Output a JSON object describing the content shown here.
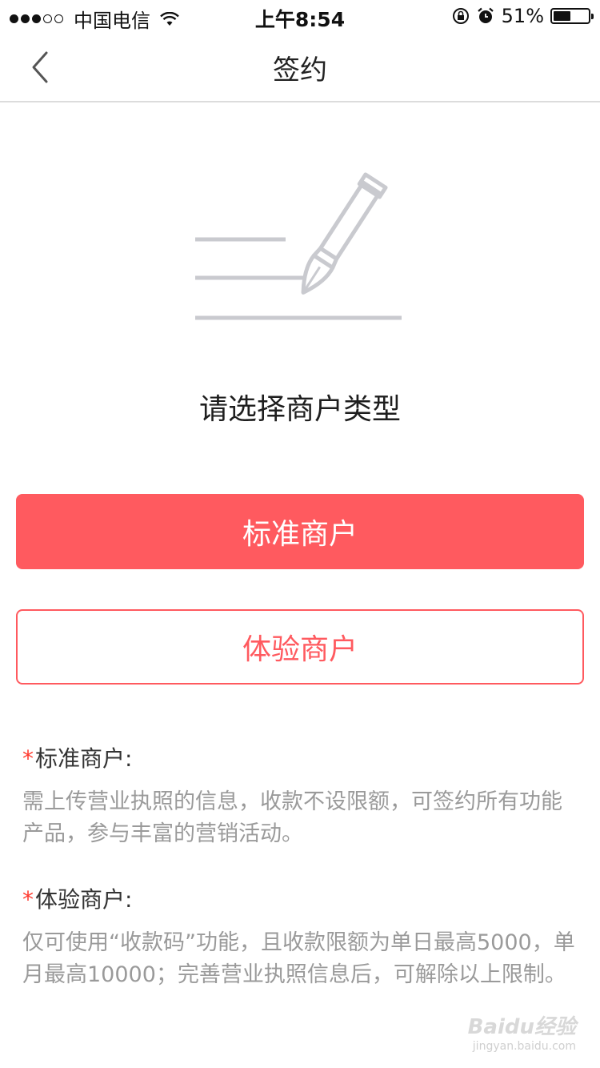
{
  "status_bar": {
    "carrier": "中国电信",
    "time": "上午8:54",
    "battery_percent_label": "51%",
    "battery_level": 0.51,
    "signal_bars_filled": 3,
    "signal_bars_total": 5
  },
  "nav": {
    "title": "签约",
    "back_icon": "chevron-left-icon"
  },
  "illustration": {
    "icon": "pen-writing-lines-icon",
    "color": "#c9cacf"
  },
  "heading": "请选择商户类型",
  "buttons": {
    "standard": "标准商户",
    "trial": "体验商户"
  },
  "descriptions": [
    {
      "asterisk": "*",
      "title": "标准商户:",
      "body": "需上传营业执照的信息，收款不设限额，可签约所有功能产品，参与丰富的营销活动。"
    },
    {
      "asterisk": "*",
      "title": "体验商户:",
      "body": "仅可使用“收款码”功能，且收款限额为单日最高5000，单月最高10000；完善营业执照信息后，可解除以上限制。"
    }
  ],
  "watermark": {
    "brand": "Baidu经验",
    "url": "jingyan.baidu.com"
  },
  "colors": {
    "accent": "#ff5a5f",
    "required": "#ff3b30",
    "muted_text": "#9a9a9a"
  }
}
